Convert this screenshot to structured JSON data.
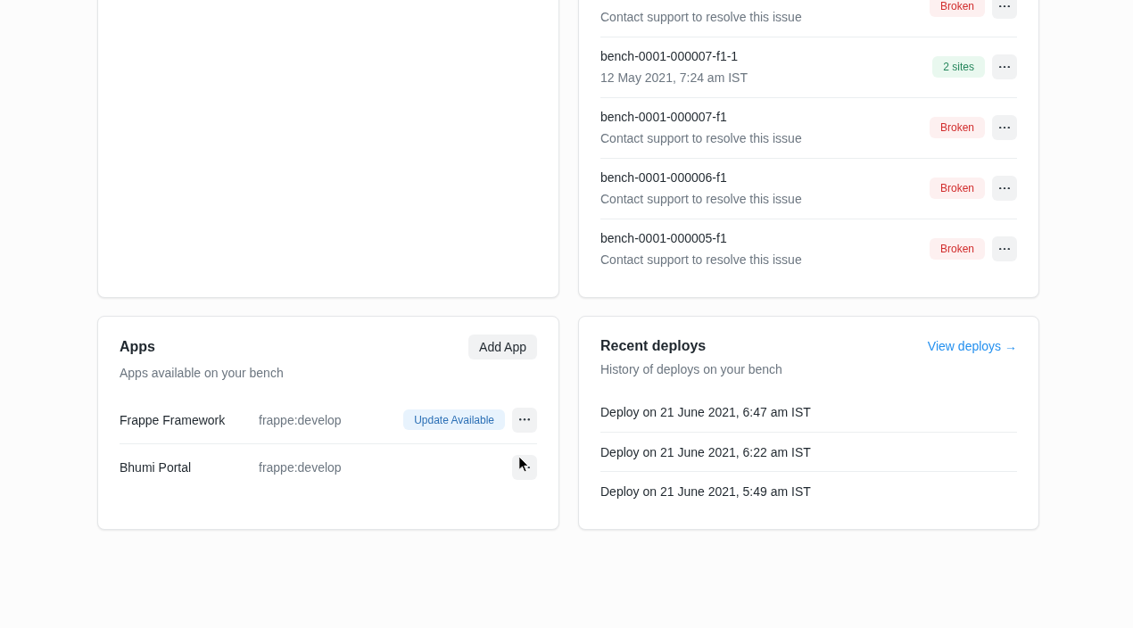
{
  "bench_list": {
    "rows": [
      {
        "subtitle": "Contact support to resolve this issue",
        "badge": {
          "label": "Broken",
          "kind": "danger"
        }
      },
      {
        "title": "bench-0001-000007-f1-1",
        "subtitle": "12 May 2021, 7:24 am IST",
        "badge": {
          "label": "2 sites",
          "kind": "success"
        }
      },
      {
        "title": "bench-0001-000007-f1",
        "subtitle": "Contact support to resolve this issue",
        "badge": {
          "label": "Broken",
          "kind": "danger"
        }
      },
      {
        "title": "bench-0001-000006-f1",
        "subtitle": "Contact support to resolve this issue",
        "badge": {
          "label": "Broken",
          "kind": "danger"
        }
      },
      {
        "title": "bench-0001-000005-f1",
        "subtitle": "Contact support to resolve this issue",
        "badge": {
          "label": "Broken",
          "kind": "danger"
        }
      }
    ]
  },
  "apps": {
    "title": "Apps",
    "button": "Add App",
    "subtitle": "Apps available on your bench",
    "items": [
      {
        "name": "Frappe Framework",
        "branch": "frappe:develop",
        "badge": {
          "label": "Update Available",
          "kind": "info"
        },
        "hovered": false
      },
      {
        "name": "Bhumi Portal",
        "branch": "frappe:develop",
        "hovered": true
      }
    ]
  },
  "recent_deploys": {
    "title": "Recent deploys",
    "link": "View deploys →",
    "subtitle": "History of deploys on your bench",
    "items": [
      "Deploy on 21 June 2021, 6:47 am IST",
      "Deploy on 21 June 2021, 6:22 am IST",
      "Deploy on 21 June 2021, 5:49 am IST"
    ]
  }
}
